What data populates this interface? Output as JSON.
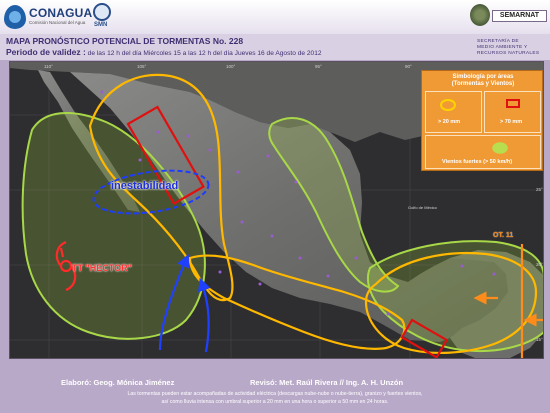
{
  "header": {
    "brand_name": "CONAGUA",
    "brand_sub": "Comisión Nacional del Agua",
    "smn": "SMN",
    "semarnat": "SEMARNAT"
  },
  "titlebar": {
    "title": "MAPA PRONÓSTICO POTENCIAL DE TORMENTAS   No. 228",
    "validity_label": "Periodo de validez :",
    "validity_text": " de las 12 h del día Miércoles 15 a las 12 h del día Jueves 16 de Agosto de 2012",
    "agency": [
      "SECRETARÍA DE",
      "MEDIO AMBIENTE Y",
      "RECURSOS NATURALES"
    ]
  },
  "map": {
    "longitudes": [
      "110°",
      "105°",
      "100°",
      "95°",
      "90°"
    ],
    "latitudes": [
      "30°",
      "25°",
      "20°",
      "15°"
    ],
    "labels": {
      "inestabilidad": "inestabilidad",
      "hector": "TT \"HECTOR\"",
      "ot": "OT. 11",
      "golfo": "Golfo de México"
    }
  },
  "legend": {
    "title_line1": "Simbología por áreas",
    "title_line2": "(Tormentas y Vientos)",
    "rain_low": "> 20 mm",
    "rain_high": "> 70 mm",
    "wind": "Vientos fuertes (> 50 km/h)",
    "colors": {
      "rain_low": "#ffd400",
      "rain_high": "#e01010",
      "wind": "#b8dd4e"
    }
  },
  "footer": {
    "elaboro": "Elaboró: Geog. Mónica Jiménez",
    "reviso": "Revisó: Met. Raúl Rivera // Ing. A. H. Unzón",
    "note_line1": "Las tormentas pueden estar acompañadas de actividad eléctrica (descargas nube-nube o nube-tierra), granizo y fuertes vientos,",
    "note_line2": "así como lluvia intensa con umbral superior a 20 mm en una hora o superior a 50 mm en 24 horas."
  }
}
